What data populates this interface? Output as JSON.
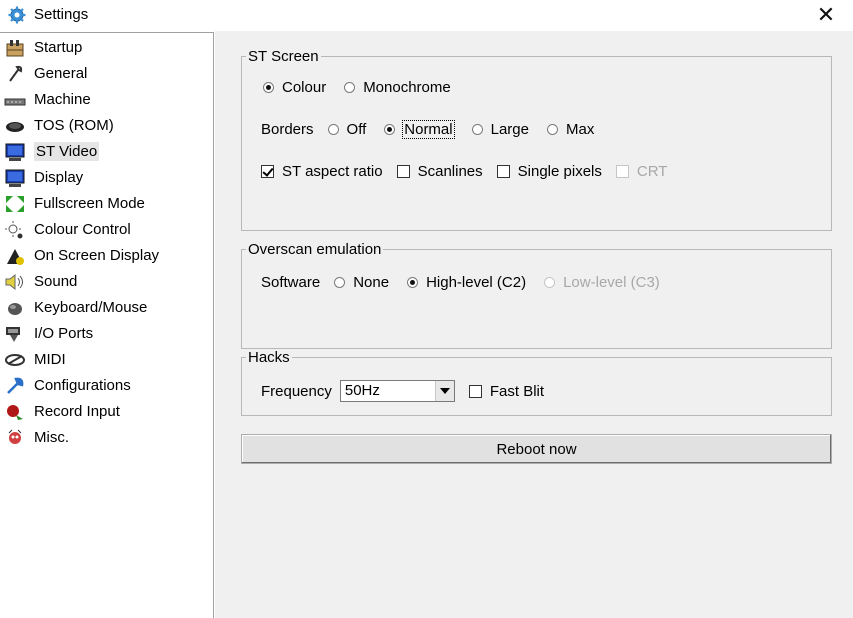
{
  "window": {
    "title": "Settings",
    "close_glyph": "✕"
  },
  "sidebar": {
    "selected_index": 4,
    "items": [
      {
        "label": "Startup",
        "icon": "startup-icon"
      },
      {
        "label": "General",
        "icon": "wrench-icon"
      },
      {
        "label": "Machine",
        "icon": "machine-icon"
      },
      {
        "label": "TOS (ROM)",
        "icon": "chip-icon"
      },
      {
        "label": "ST Video",
        "icon": "monitor-icon"
      },
      {
        "label": "Display",
        "icon": "monitor-icon"
      },
      {
        "label": "Fullscreen Mode",
        "icon": "fullscreen-icon"
      },
      {
        "label": "Colour Control",
        "icon": "colour-icon"
      },
      {
        "label": "On Screen Display",
        "icon": "osd-icon"
      },
      {
        "label": "Sound",
        "icon": "speaker-icon"
      },
      {
        "label": "Keyboard/Mouse",
        "icon": "mouse-icon"
      },
      {
        "label": "I/O Ports",
        "icon": "ports-icon"
      },
      {
        "label": "MIDI",
        "icon": "midi-icon"
      },
      {
        "label": "Configurations",
        "icon": "configurations-icon"
      },
      {
        "label": "Record Input",
        "icon": "record-icon"
      },
      {
        "label": "Misc.",
        "icon": "misc-icon"
      }
    ]
  },
  "st_screen": {
    "title": "ST Screen",
    "colour": "Colour",
    "monochrome": "Monochrome",
    "colour_selected": true,
    "borders_label": "Borders",
    "borders": [
      "Off",
      "Normal",
      "Large",
      "Max"
    ],
    "borders_selected": "Normal",
    "aspect": "ST aspect ratio",
    "aspect_checked": true,
    "scanlines": "Scanlines",
    "single_pixels": "Single pixels",
    "crt": "CRT"
  },
  "overscan": {
    "title": "Overscan emulation",
    "software_label": "Software",
    "none": "None",
    "high": "High-level (C2)",
    "low": "Low-level (C3)",
    "selected": "High-level (C2)"
  },
  "hacks": {
    "title": "Hacks",
    "frequency_label": "Frequency",
    "frequency_value": "50Hz",
    "fast_blit": "Fast Blit"
  },
  "reboot_label": "Reboot now",
  "colors": {
    "selected_bg": "#e5e5e5",
    "panel_bg": "#f0f0f0",
    "disabled_text": "#a8a8a8"
  }
}
